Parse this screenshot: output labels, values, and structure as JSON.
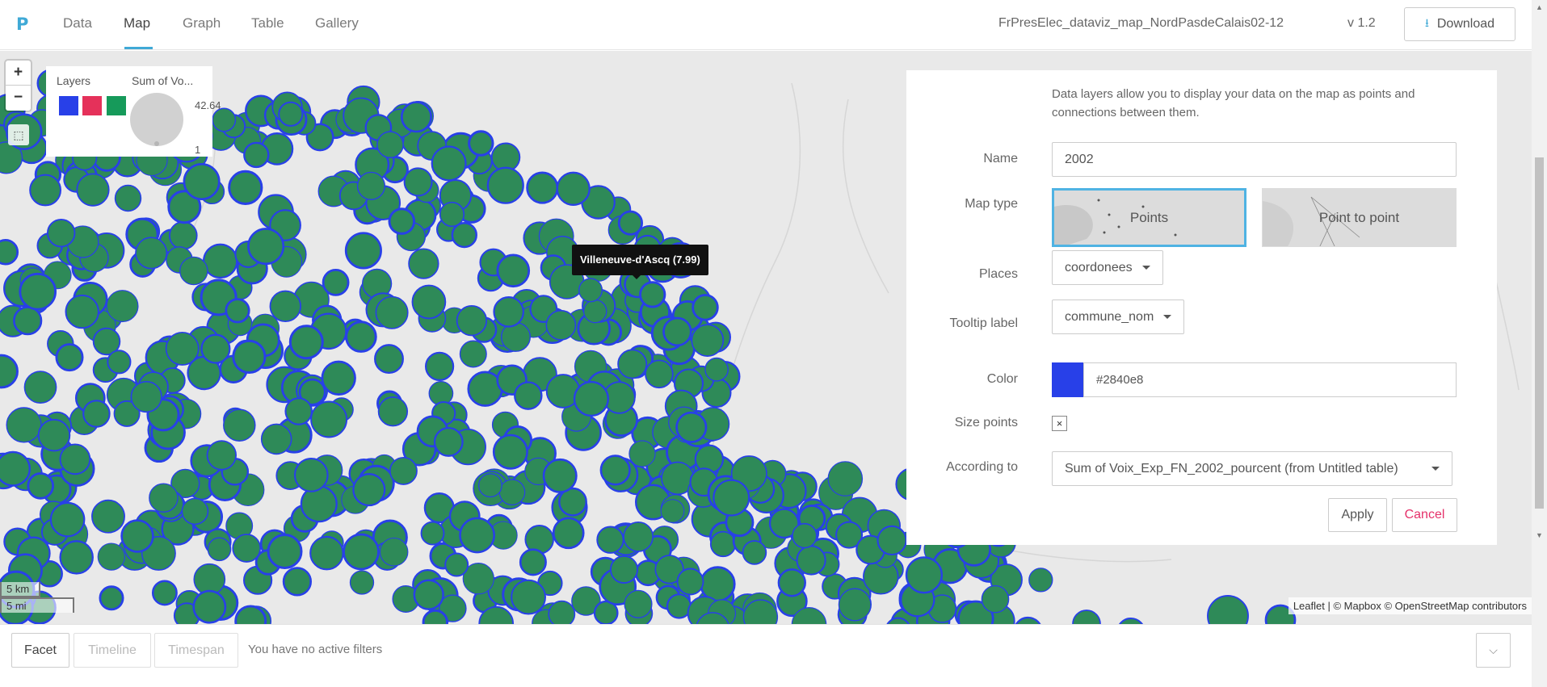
{
  "app": {
    "logo": "P",
    "tabs": [
      {
        "label": "Data"
      },
      {
        "label": "Map"
      },
      {
        "label": "Graph"
      },
      {
        "label": "Table"
      },
      {
        "label": "Gallery"
      }
    ],
    "active_tab": "Map",
    "project_title": "FrPresElec_dataviz_map_NordPasdeCalais02-12",
    "version": "v 1.2",
    "download_label": "Download",
    "download_icon": "download-icon",
    "accent_color": "#3fa9d6"
  },
  "map": {
    "zoom_in": "+",
    "zoom_out": "−",
    "legend": {
      "layers_title": "Layers",
      "size_title": "Sum of Vo...",
      "layer_colors": [
        "#2840e8",
        "#e5315a",
        "#169a5a"
      ],
      "max_value": "42.64",
      "min_value": "1"
    },
    "tooltip": "Villeneuve-d'Ascq (7.99)",
    "scale_km": "5 km",
    "scale_mi": "5 mi",
    "attribution": "Leaflet | © Mapbox © OpenStreetMap contributors",
    "point_colors": {
      "fill": "#2e8a58",
      "stroke": "#2840e8"
    }
  },
  "panel": {
    "intro": "Data layers allow you to display your data on the map as points and connections between them.",
    "name_label": "Name",
    "name_value": "2002",
    "maptype_label": "Map type",
    "maptype_points": "Points",
    "maptype_p2p": "Point to point",
    "places_label": "Places",
    "places_value": "coordonees",
    "tooltip_label": "Tooltip label",
    "tooltip_value": "commune_nom",
    "color_label": "Color",
    "color_value": "#2840e8",
    "size_label": "Size points",
    "size_checked": "×",
    "according_label": "According to",
    "according_value": "Sum of Voix_Exp_FN_2002_pourcent (from Untitled table)",
    "apply_label": "Apply",
    "cancel_label": "Cancel"
  },
  "filters": {
    "facet": "Facet",
    "timeline": "Timeline",
    "timespan": "Timespan",
    "status": "You have no active filters"
  }
}
